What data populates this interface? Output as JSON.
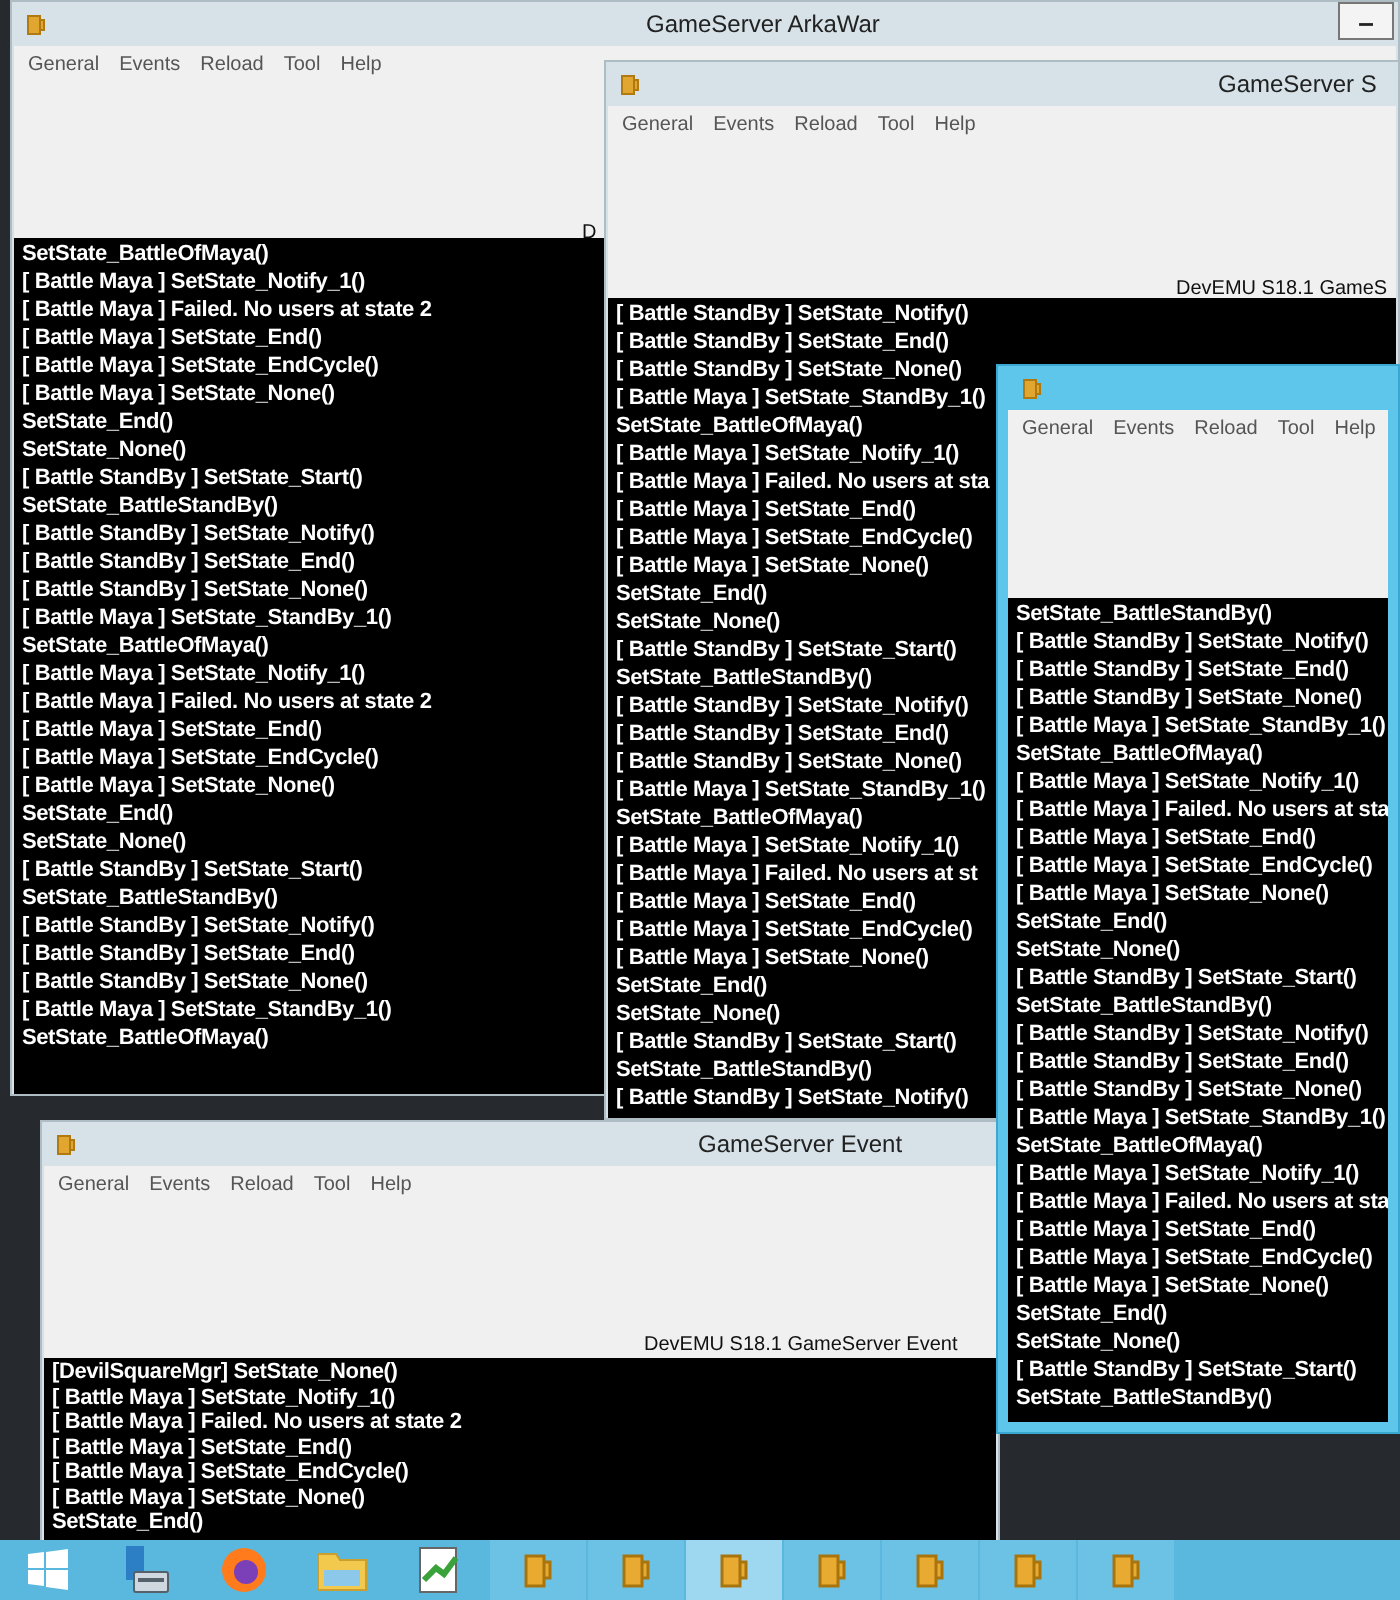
{
  "windows": [
    {
      "title": "GameServer ArkaWar",
      "active": false,
      "minimize_button": "–",
      "menu": [
        "General",
        "Events",
        "Reload",
        "Tool",
        "Help"
      ],
      "banner": "D",
      "log": [
        "SetState_BattleOfMaya()",
        "[ Battle Maya ] SetState_Notify_1()",
        "[ Battle Maya ] Failed. No users at state 2",
        "[ Battle Maya ] SetState_End()",
        "[ Battle Maya ] SetState_EndCycle()",
        "[ Battle Maya ] SetState_None()",
        "SetState_End()",
        "SetState_None()",
        "[ Battle StandBy ] SetState_Start()",
        "SetState_BattleStandBy()",
        "[ Battle StandBy ] SetState_Notify()",
        "[ Battle StandBy ] SetState_End()",
        "[ Battle StandBy ] SetState_None()",
        "[ Battle Maya ] SetState_StandBy_1()",
        "SetState_BattleOfMaya()",
        "[ Battle Maya ] SetState_Notify_1()",
        "[ Battle Maya ] Failed. No users at state 2",
        "[ Battle Maya ] SetState_End()",
        "[ Battle Maya ] SetState_EndCycle()",
        "[ Battle Maya ] SetState_None()",
        "SetState_End()",
        "SetState_None()",
        "[ Battle StandBy ] SetState_Start()",
        "SetState_BattleStandBy()",
        "[ Battle StandBy ] SetState_Notify()",
        "[ Battle StandBy ] SetState_End()",
        "[ Battle StandBy ] SetState_None()",
        "[ Battle Maya ] SetState_StandBy_1()",
        "SetState_BattleOfMaya()"
      ]
    },
    {
      "title": "GameServer S",
      "active": false,
      "menu": [
        "General",
        "Events",
        "Reload",
        "Tool",
        "Help"
      ],
      "banner": "DevEMU S18.1 GameS",
      "log": [
        "[ Battle StandBy ] SetState_Notify()",
        "[ Battle StandBy ] SetState_End()",
        "[ Battle StandBy ] SetState_None()",
        "[ Battle Maya ] SetState_StandBy_1()",
        "SetState_BattleOfMaya()",
        "[ Battle Maya ] SetState_Notify_1()",
        "[ Battle Maya ] Failed. No users at sta",
        "[ Battle Maya ] SetState_End()",
        "[ Battle Maya ] SetState_EndCycle()",
        "[ Battle Maya ] SetState_None()",
        "SetState_End()",
        "SetState_None()",
        "[ Battle StandBy ] SetState_Start()",
        "SetState_BattleStandBy()",
        "[ Battle StandBy ] SetState_Notify()",
        "[ Battle StandBy ] SetState_End()",
        "[ Battle StandBy ] SetState_None()",
        "[ Battle Maya ] SetState_StandBy_1()",
        "SetState_BattleOfMaya()",
        "[ Battle Maya ] SetState_Notify_1()",
        "[ Battle Maya ] Failed. No users at st",
        "[ Battle Maya ] SetState_End()",
        "[ Battle Maya ] SetState_EndCycle()",
        "[ Battle Maya ] SetState_None()",
        "SetState_End()",
        "SetState_None()",
        "[ Battle StandBy ] SetState_Start()",
        "SetState_BattleStandBy()",
        "[ Battle StandBy ] SetState_Notify()"
      ]
    },
    {
      "title": "GameServer Event",
      "active": false,
      "menu": [
        "General",
        "Events",
        "Reload",
        "Tool",
        "Help"
      ],
      "banner": "DevEMU S18.1 GameServer Event",
      "log": [
        "[DevilSquareMgr] SetState_None()",
        "[ Battle Maya ] SetState_Notify_1()",
        "[ Battle Maya ] Failed. No users at state 2",
        "[ Battle Maya ] SetState_End()",
        "[ Battle Maya ] SetState_EndCycle()",
        "[ Battle Maya ] SetState_None()",
        "SetState_End()"
      ]
    },
    {
      "active": true,
      "menu": [
        "General",
        "Events",
        "Reload",
        "Tool",
        "Help"
      ],
      "log": [
        "SetState_BattleStandBy()",
        "[ Battle StandBy ] SetState_Notify()",
        "[ Battle StandBy ] SetState_End()",
        "[ Battle StandBy ] SetState_None()",
        "[ Battle Maya ] SetState_StandBy_1()",
        "SetState_BattleOfMaya()",
        "[ Battle Maya ] SetState_Notify_1()",
        "[ Battle Maya ] Failed. No users at sta",
        "[ Battle Maya ] SetState_End()",
        "[ Battle Maya ] SetState_EndCycle()",
        "[ Battle Maya ] SetState_None()",
        "SetState_End()",
        "SetState_None()",
        "[ Battle StandBy ] SetState_Start()",
        "SetState_BattleStandBy()",
        "[ Battle StandBy ] SetState_Notify()",
        "[ Battle StandBy ] SetState_End()",
        "[ Battle StandBy ] SetState_None()",
        "[ Battle Maya ] SetState_StandBy_1()",
        "SetState_BattleOfMaya()",
        "[ Battle Maya ] SetState_Notify_1()",
        "[ Battle Maya ] Failed. No users at sta",
        "[ Battle Maya ] SetState_End()",
        "[ Battle Maya ] SetState_EndCycle()",
        "[ Battle Maya ] SetState_None()",
        "SetState_End()",
        "SetState_None()",
        "[ Battle StandBy ] SetState_Start()",
        "SetState_BattleStandBy()"
      ]
    }
  ],
  "taskbar": {
    "pinned": [
      {
        "kind": "start"
      },
      {
        "kind": "server"
      },
      {
        "kind": "browser"
      },
      {
        "kind": "folder"
      },
      {
        "kind": "editor"
      }
    ],
    "apps": [
      {
        "selected": false
      },
      {
        "selected": false
      },
      {
        "selected": true
      },
      {
        "selected": false
      },
      {
        "selected": false
      },
      {
        "selected": false
      },
      {
        "selected": false
      }
    ]
  }
}
